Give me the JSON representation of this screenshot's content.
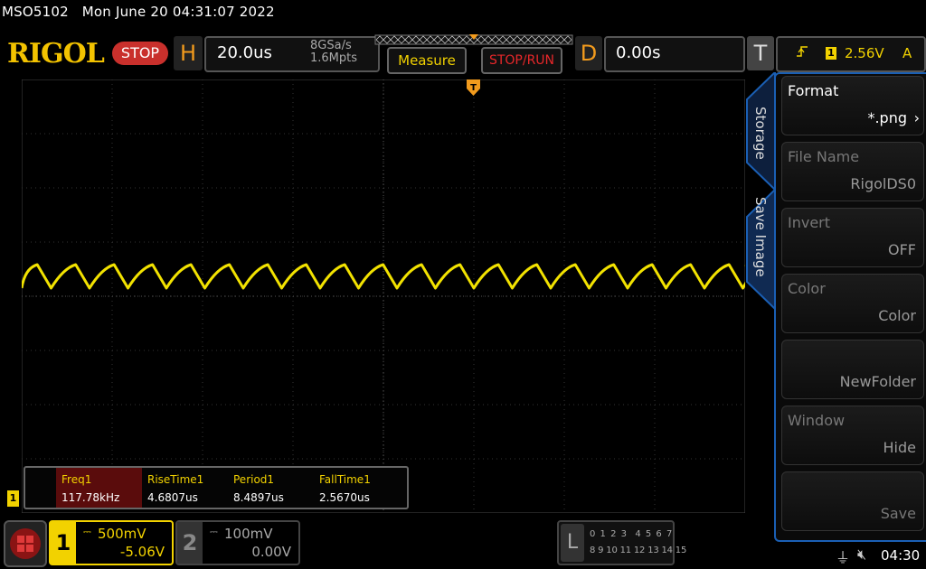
{
  "topline": {
    "model": "MSO5102",
    "datetime": "Mon June 20 04:31:07 2022"
  },
  "header": {
    "logo": "RIGOL",
    "run_state": "STOP",
    "horizontal": {
      "letter": "H",
      "timebase": "20.0us",
      "sample_rate": "8GSa/s",
      "mem_depth": "1.6Mpts"
    },
    "measure_label": "Measure",
    "stoprun_label": "STOP/RUN",
    "delay": {
      "letter": "D",
      "value": "0.00s"
    },
    "trigger": {
      "letter": "T",
      "edge_icon": "rising-edge-icon",
      "channel": "1",
      "level": "2.56V",
      "mode": "A"
    }
  },
  "colors": {
    "ch1": "#f2d200",
    "accent_orange": "#f29b1d",
    "menu_border": "#1a5fb4",
    "stop_red": "#c9302c"
  },
  "measurements": [
    {
      "name": "Freq1",
      "value": "117.78kHz"
    },
    {
      "name": "RiseTime1",
      "value": "4.6807us"
    },
    {
      "name": "Period1",
      "value": "8.4897us"
    },
    {
      "name": "FallTime1",
      "value": "2.5670us"
    }
  ],
  "menu": {
    "tabs": [
      "Storage",
      "Save Image"
    ],
    "items": [
      {
        "title": "Format",
        "value": "*.png"
      },
      {
        "title": "File Name",
        "value": "RigolDS0"
      },
      {
        "title": "Invert",
        "value": "OFF"
      },
      {
        "title": "Color",
        "value": "Color"
      },
      {
        "title": "",
        "value": "NewFolder"
      },
      {
        "title": "Window",
        "value": "Hide"
      },
      {
        "title": "",
        "value": "Save"
      }
    ]
  },
  "channels": {
    "ch1": {
      "number": "1",
      "scale": "500mV",
      "offset": "-5.06V"
    },
    "ch2": {
      "number": "2",
      "scale": "100mV",
      "offset": "0.00V"
    }
  },
  "la": {
    "letter": "L",
    "row1": "0 1 2 3  4 5 6 7",
    "row2": "8 9 10 11 12 13 14 15"
  },
  "ch1_ground_marker": "1",
  "status": {
    "time": "04:30",
    "usb_icon": "usb-icon",
    "speaker_icon": "speaker-muted-icon"
  }
}
